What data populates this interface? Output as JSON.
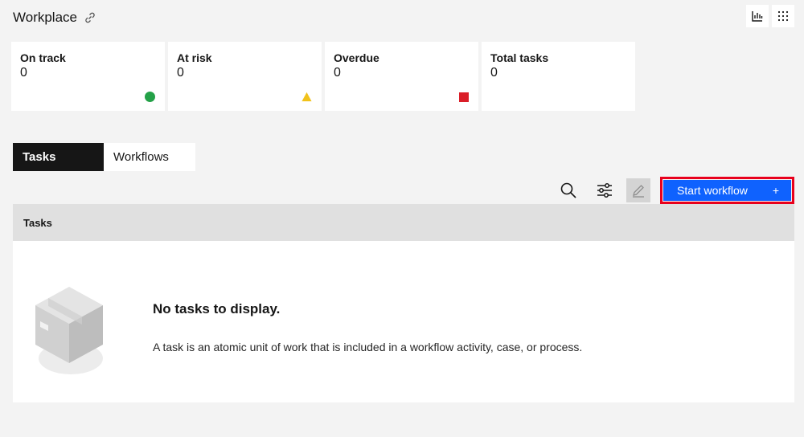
{
  "header": {
    "title": "Workplace",
    "link_icon": "link-icon"
  },
  "top_actions": [
    {
      "icon": "bar-chart-icon"
    },
    {
      "icon": "grid-menu-icon"
    }
  ],
  "tiles": [
    {
      "label": "On track",
      "value": "0",
      "marker": "circle",
      "color": "#24a148"
    },
    {
      "label": "At risk",
      "value": "0",
      "marker": "triangle",
      "color": "#f1c21b"
    },
    {
      "label": "Overdue",
      "value": "0",
      "marker": "square",
      "color": "#da1e28"
    },
    {
      "label": "Total tasks",
      "value": "0"
    }
  ],
  "tabs": [
    {
      "label": "Tasks",
      "active": true
    },
    {
      "label": "Workflows",
      "active": false
    }
  ],
  "toolbar": {
    "search_icon": "search-icon",
    "filter_icon": "filter-icon",
    "edit_icon": "edit-icon",
    "start_label": "Start workflow",
    "start_icon": "+",
    "accent": "#0f62fe"
  },
  "table": {
    "header": "Tasks",
    "empty_title": "No tasks to display.",
    "empty_description": "A task is an atomic unit of work that is included in a workflow activity, case, or process."
  }
}
